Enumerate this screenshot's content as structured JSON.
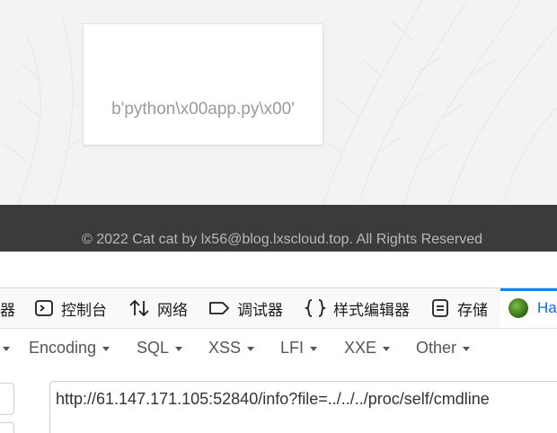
{
  "site": {
    "card_text": "b'python\\x00app.py\\x00'",
    "footer": "© 2022 Cat cat by lx56@blog.lxscloud.top. All Rights Reserved"
  },
  "devtools": {
    "tabs": [
      {
        "label": "器",
        "icon": "inspector-icon"
      },
      {
        "label": "控制台",
        "icon": "console-icon"
      },
      {
        "label": "网络",
        "icon": "network-icon"
      },
      {
        "label": "调试器",
        "icon": "debugger-icon"
      },
      {
        "label": "样式编辑器",
        "icon": "style-editor-icon"
      },
      {
        "label": "存储",
        "icon": "storage-icon"
      },
      {
        "label": "Ha",
        "icon": "hackbar-icon",
        "active": true
      }
    ],
    "menus": [
      "Encoding",
      "SQL",
      "XSS",
      "LFI",
      "XXE",
      "Other"
    ],
    "url_value": "http://61.147.171.105:52840/info?file=../../../proc/self/cmdline"
  },
  "colors": {
    "accent": "#0a84ff",
    "footer_bg": "#3b3b3b"
  }
}
